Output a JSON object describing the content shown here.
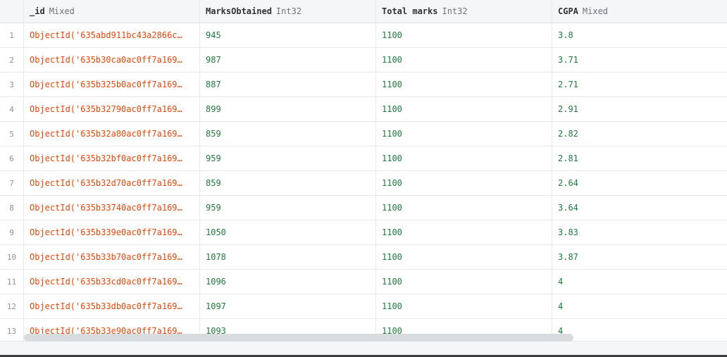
{
  "columns": [
    {
      "name": "_id",
      "type": "Mixed"
    },
    {
      "name": "MarksObtained",
      "type": "Int32"
    },
    {
      "name": "Total marks",
      "type": "Int32"
    },
    {
      "name": "CGPA",
      "type": "Mixed"
    }
  ],
  "rows": [
    {
      "n": "1",
      "id": "ObjectId('635abd911bc43a2866c…",
      "marks": "945",
      "total": "1100",
      "cgpa": "3.8"
    },
    {
      "n": "2",
      "id": "ObjectId('635b30ca0ac0ff7a169…",
      "marks": "987",
      "total": "1100",
      "cgpa": "3.71"
    },
    {
      "n": "3",
      "id": "ObjectId('635b325b0ac0ff7a169…",
      "marks": "887",
      "total": "1100",
      "cgpa": "2.71"
    },
    {
      "n": "4",
      "id": "ObjectId('635b32790ac0ff7a169…",
      "marks": "899",
      "total": "1100",
      "cgpa": "2.91"
    },
    {
      "n": "5",
      "id": "ObjectId('635b32a80ac0ff7a169…",
      "marks": "859",
      "total": "1100",
      "cgpa": "2.82"
    },
    {
      "n": "6",
      "id": "ObjectId('635b32bf0ac0ff7a169…",
      "marks": "959",
      "total": "1100",
      "cgpa": "2.81"
    },
    {
      "n": "7",
      "id": "ObjectId('635b32d70ac0ff7a169…",
      "marks": "859",
      "total": "1100",
      "cgpa": "2.64"
    },
    {
      "n": "8",
      "id": "ObjectId('635b33740ac0ff7a169…",
      "marks": "959",
      "total": "1100",
      "cgpa": "3.64"
    },
    {
      "n": "9",
      "id": "ObjectId('635b339e0ac0ff7a169…",
      "marks": "1050",
      "total": "1100",
      "cgpa": "3.83"
    },
    {
      "n": "10",
      "id": "ObjectId('635b33b70ac0ff7a169…",
      "marks": "1078",
      "total": "1100",
      "cgpa": "3.87"
    },
    {
      "n": "11",
      "id": "ObjectId('635b33cd0ac0ff7a169…",
      "marks": "1096",
      "total": "1100",
      "cgpa": "4"
    },
    {
      "n": "12",
      "id": "ObjectId('635b33db0ac0ff7a169…",
      "marks": "1097",
      "total": "1100",
      "cgpa": "4"
    },
    {
      "n": "13",
      "id": "ObjectId('635b33e90ac0ff7a169…",
      "marks": "1093",
      "total": "1100",
      "cgpa": "4"
    }
  ]
}
